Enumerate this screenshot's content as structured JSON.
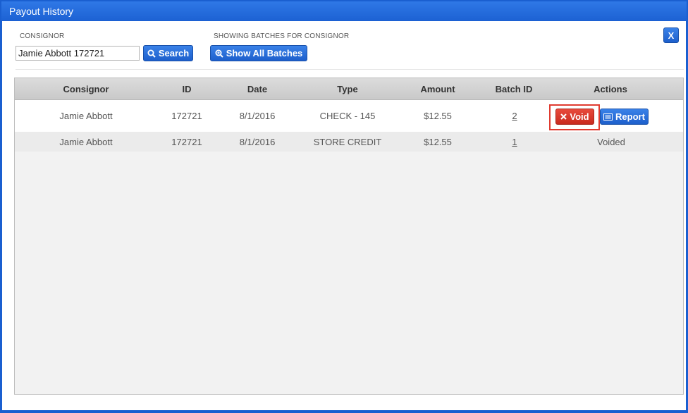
{
  "window": {
    "title": "Payout History",
    "close_label": "X"
  },
  "filter": {
    "consignor_label": "CONSIGNOR",
    "consignor_value": "Jamie Abbott 172721",
    "search_label": "Search",
    "showing_label": "SHOWING BATCHES FOR CONSIGNOR",
    "show_all_label": "Show All Batches"
  },
  "table": {
    "columns": [
      "Consignor",
      "ID",
      "Date",
      "Type",
      "Amount",
      "Batch ID",
      "Actions"
    ],
    "rows": [
      {
        "consignor": "Jamie Abbott",
        "id": "172721",
        "date": "8/1/2016",
        "type": "CHECK - 145",
        "amount": "$12.55",
        "batch_id": "2",
        "void_label": "Void",
        "report_label": "Report"
      },
      {
        "consignor": "Jamie Abbott",
        "id": "172721",
        "date": "8/1/2016",
        "type": "STORE CREDIT",
        "amount": "$12.55",
        "batch_id": "1",
        "status": "Voided"
      }
    ]
  },
  "colors": {
    "titlebar": "#1c61d3",
    "button_primary": "#1d5fcc",
    "button_danger": "#c92b1f",
    "highlight": "#e03b30"
  },
  "icons": {
    "search": "search-icon",
    "show_all": "zoom-in-icon",
    "void": "x-icon",
    "report": "report-icon"
  }
}
